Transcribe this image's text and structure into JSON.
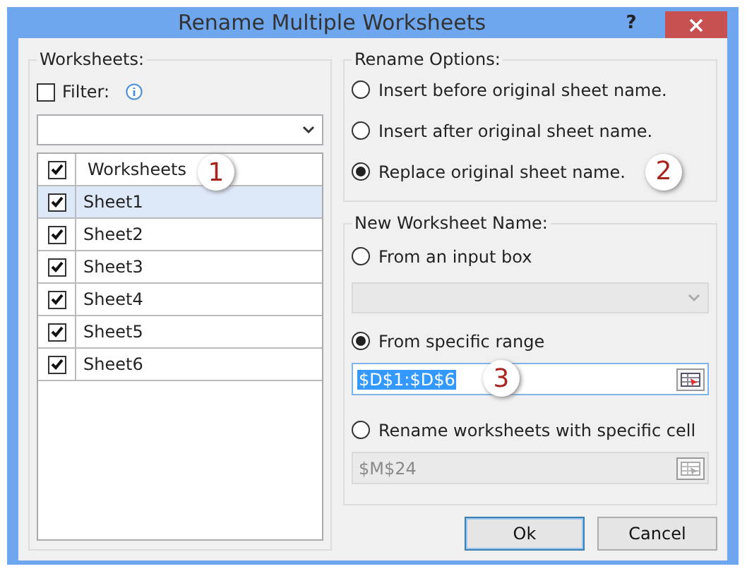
{
  "window": {
    "title": "Rename Multiple Worksheets",
    "help": "?"
  },
  "worksheets": {
    "title": "Worksheets:",
    "filter": {
      "label": "Filter:",
      "checked": false
    },
    "header": {
      "label": "Worksheets",
      "checked": true,
      "callout": "1"
    },
    "rows": [
      {
        "label": "Sheet1",
        "checked": true,
        "selected": true
      },
      {
        "label": "Sheet2",
        "checked": true,
        "selected": false
      },
      {
        "label": "Sheet3",
        "checked": true,
        "selected": false
      },
      {
        "label": "Sheet4",
        "checked": true,
        "selected": false
      },
      {
        "label": "Sheet5",
        "checked": true,
        "selected": false
      },
      {
        "label": "Sheet6",
        "checked": true,
        "selected": false
      }
    ]
  },
  "rename_options": {
    "title": "Rename Options:",
    "options": [
      {
        "label": "Insert before original sheet name.",
        "selected": false
      },
      {
        "label": "Insert after original sheet name.",
        "selected": false
      },
      {
        "label": "Replace original sheet name.",
        "selected": true,
        "callout": "2"
      }
    ]
  },
  "new_name": {
    "title": "New Worksheet Name:",
    "sources": [
      {
        "kind": "combo",
        "label": "From an input box",
        "selected": false,
        "disabled": true
      },
      {
        "kind": "range",
        "label": "From specific range",
        "selected": true,
        "disabled": false,
        "value": "$D$1:$D$6",
        "value_selected": true,
        "callout": "3"
      },
      {
        "kind": "range",
        "label": "Rename worksheets with specific cell",
        "selected": false,
        "disabled": true,
        "value": "$M$24",
        "value_selected": false
      }
    ]
  },
  "buttons": [
    {
      "label": "Ok",
      "default": true
    },
    {
      "label": "Cancel",
      "default": false
    }
  ]
}
